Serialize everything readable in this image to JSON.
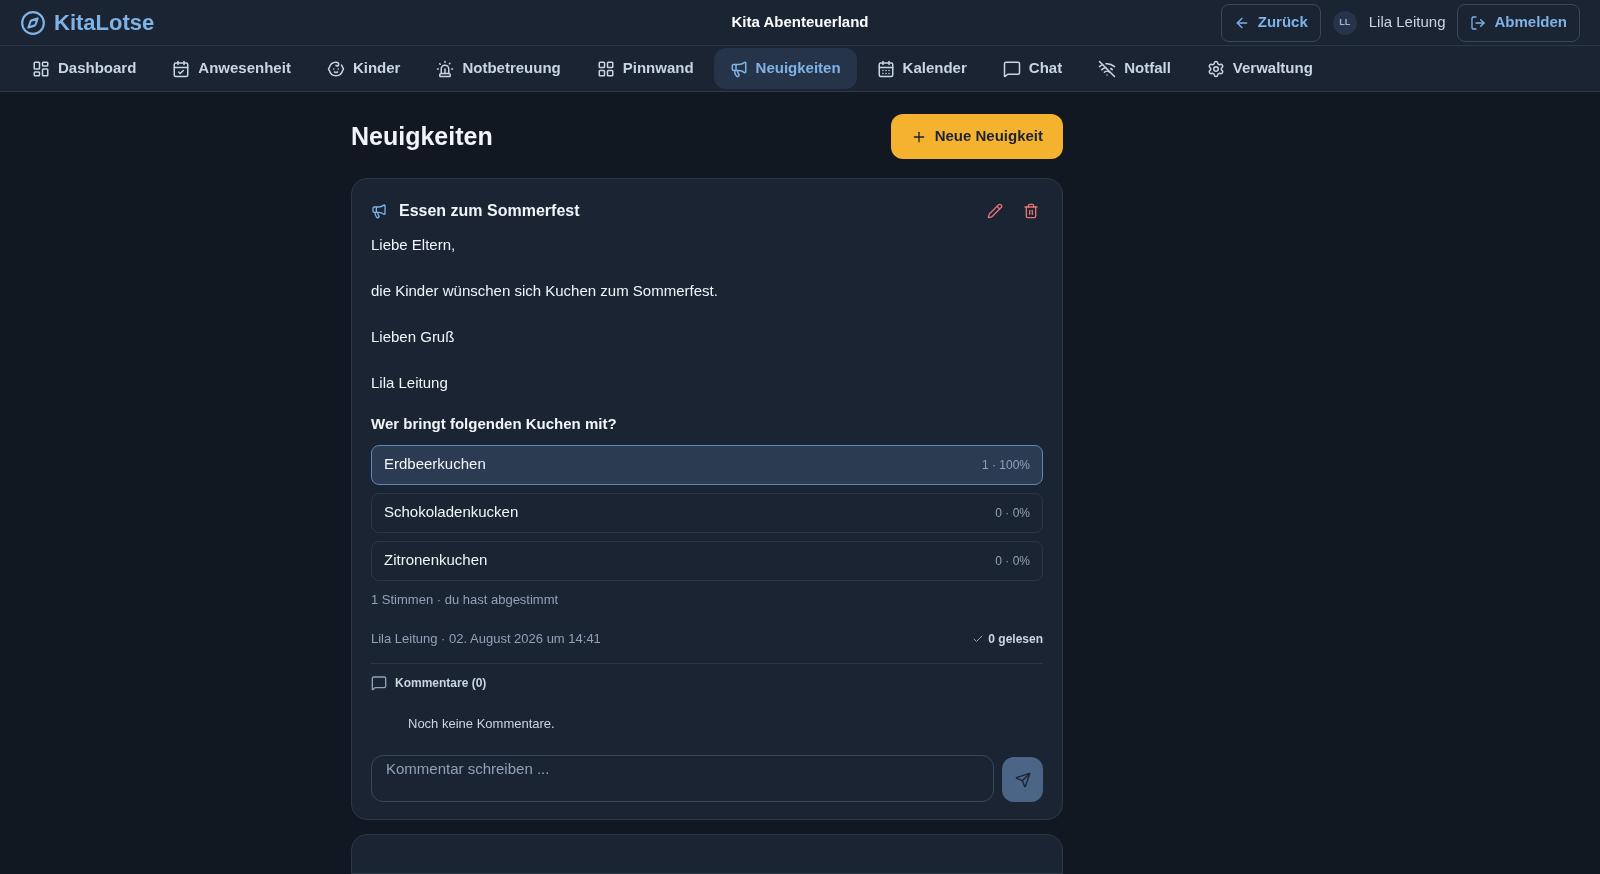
{
  "header": {
    "logo": "KitaLotse",
    "title": "Kita Abenteuerland",
    "back": "Zurück",
    "user": {
      "initials": "LL",
      "name": "Lila Leitung"
    },
    "logout": "Abmelden"
  },
  "nav": [
    {
      "label": "Dashboard",
      "selected": false
    },
    {
      "label": "Anwesenheit",
      "selected": false
    },
    {
      "label": "Kinder",
      "selected": false
    },
    {
      "label": "Notbetreuung",
      "selected": false
    },
    {
      "label": "Pinnwand",
      "selected": false
    },
    {
      "label": "Neuigkeiten",
      "selected": true
    },
    {
      "label": "Kalender",
      "selected": false
    },
    {
      "label": "Chat",
      "selected": false
    },
    {
      "label": "Notfall",
      "selected": false
    },
    {
      "label": "Verwaltung",
      "selected": false
    }
  ],
  "page": {
    "title": "Neuigkeiten",
    "new_button": "Neue Neuigkeit"
  },
  "post": {
    "title": "Essen zum Sommerfest",
    "paragraphs": [
      "Liebe Eltern,",
      "die Kinder wünschen sich Kuchen zum Sommerfest.",
      "Lieben Gruß",
      "Lila Leitung"
    ],
    "poll": {
      "question": "Wer bringt folgenden Kuchen mit?",
      "options": [
        {
          "label": "Erdbeerkuchen",
          "result": "1 · 100%",
          "selected": true
        },
        {
          "label": "Schokoladenkucken",
          "result": "0 · 0%",
          "selected": false
        },
        {
          "label": "Zitronenkuchen",
          "result": "0 · 0%",
          "selected": false
        }
      ],
      "summary": "1 Stimmen · du hast abgestimmt"
    },
    "meta": "Lila Leitung · 02. August 2026 um 14:41",
    "read": "0 gelesen",
    "comments": {
      "title": "Kommentare (0)",
      "empty": "Noch keine Kommentare.",
      "placeholder": "Kommentar schreiben ..."
    }
  }
}
